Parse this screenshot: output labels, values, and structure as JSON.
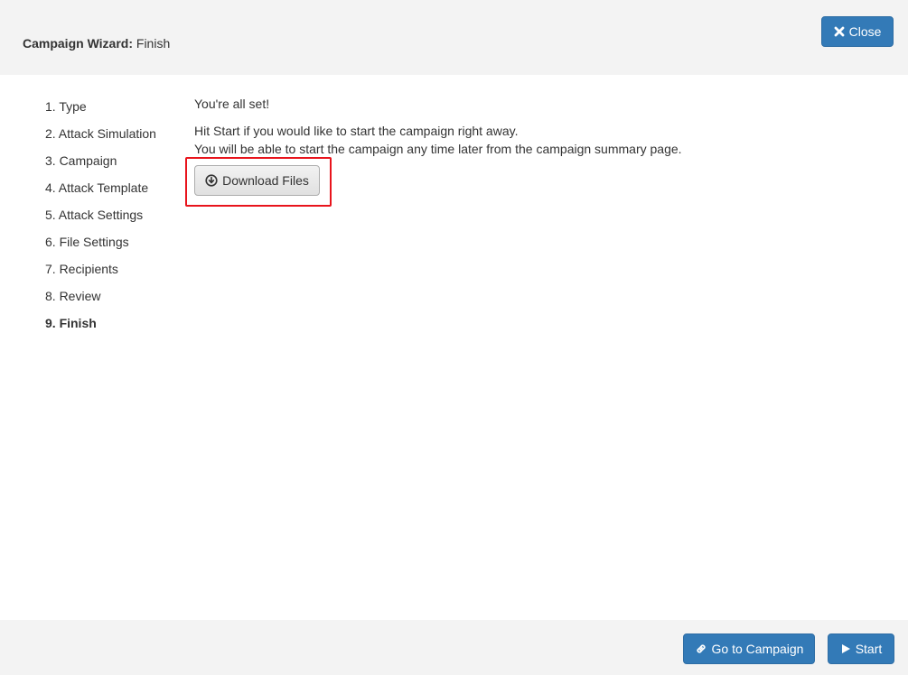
{
  "header": {
    "title_prefix": "Campaign Wizard:",
    "title_step": "Finish",
    "close_label": "Close"
  },
  "steps": [
    {
      "label": "1. Type",
      "active": false
    },
    {
      "label": "2. Attack Simulation",
      "active": false
    },
    {
      "label": "3. Campaign",
      "active": false
    },
    {
      "label": "4. Attack Template",
      "active": false
    },
    {
      "label": "5. Attack Settings",
      "active": false
    },
    {
      "label": "6. File Settings",
      "active": false
    },
    {
      "label": "7. Recipients",
      "active": false
    },
    {
      "label": "8. Review",
      "active": false
    },
    {
      "label": "9. Finish",
      "active": true
    }
  ],
  "content": {
    "heading": "You're all set!",
    "line1": "Hit Start if you would like to start the campaign right away.",
    "line2": "You will be able to start the campaign any time later from the campaign summary page.",
    "download_label": "Download Files"
  },
  "footer": {
    "go_label": "Go to Campaign",
    "start_label": "Start"
  },
  "colors": {
    "primary": "#337ab7",
    "highlight": "#e8141c",
    "header_bg": "#f3f3f3"
  },
  "icons": {
    "close": "close-icon",
    "download": "download-circle-icon",
    "link": "link-icon",
    "start": "play-icon"
  }
}
